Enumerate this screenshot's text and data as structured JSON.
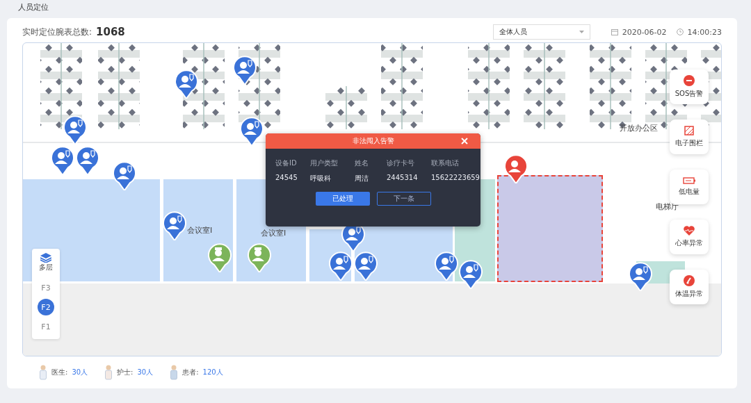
{
  "page_title": "人员定位",
  "summary": {
    "label": "实时定位腕表总数:",
    "count": "1068"
  },
  "filter": {
    "value": "全体人员"
  },
  "date": "2020-06-02",
  "time": "14:00:23",
  "map": {
    "room_labels": [
      "会议室I",
      "会议室I",
      "开放办公区",
      "电梯厅"
    ],
    "pins": [
      {
        "kind": "patient"
      },
      {
        "kind": "patient"
      },
      {
        "kind": "patient"
      },
      {
        "kind": "patient"
      },
      {
        "kind": "patient"
      },
      {
        "kind": "patient"
      },
      {
        "kind": "patient"
      },
      {
        "kind": "patient"
      },
      {
        "kind": "patient"
      },
      {
        "kind": "patient"
      },
      {
        "kind": "patient"
      },
      {
        "kind": "patient"
      },
      {
        "kind": "patient"
      },
      {
        "kind": "patient"
      },
      {
        "kind": "doctor"
      },
      {
        "kind": "nurse"
      },
      {
        "kind": "alert"
      }
    ],
    "layers_label": "多层",
    "floors": [
      {
        "label": "F3",
        "selected": false
      },
      {
        "label": "F2",
        "selected": true
      },
      {
        "label": "F1",
        "selected": false
      }
    ],
    "alert_tools": [
      {
        "label": "SOS告警",
        "kind": "sos"
      },
      {
        "label": "电子围栏",
        "kind": "fence"
      },
      {
        "label": "低电量",
        "kind": "battery"
      },
      {
        "label": "心率异常",
        "kind": "heart"
      },
      {
        "label": "体温异常",
        "kind": "temperature"
      }
    ],
    "dialog": {
      "title": "非法闯入告警",
      "columns": [
        "设备ID",
        "用户类型",
        "姓名",
        "诊疗卡号",
        "联系电话"
      ],
      "values": [
        "24545",
        "呼吸科",
        "周洁",
        "2445314",
        "15622223659"
      ],
      "buttons": [
        {
          "label": "已处理",
          "kind": "primary"
        },
        {
          "label": "下一条",
          "kind": "outline"
        }
      ]
    }
  },
  "legend": [
    {
      "kind": "doctor",
      "label": "医生:",
      "count": "30人"
    },
    {
      "kind": "nurse",
      "label": "护士:",
      "count": "30人"
    },
    {
      "kind": "patient",
      "label": "患者:",
      "count": "120人"
    }
  ]
}
